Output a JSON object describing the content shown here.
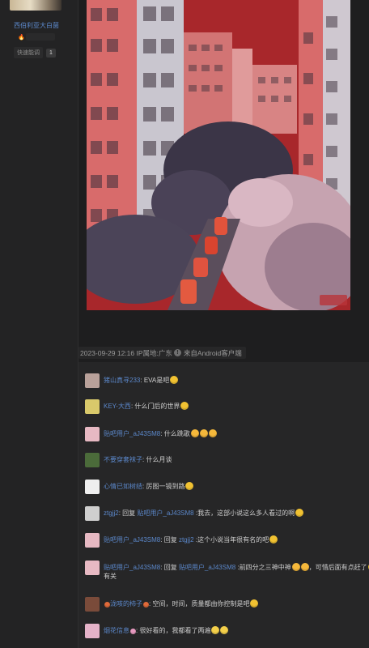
{
  "sidebar": {
    "forum_name": "西伯利亚大白菌",
    "badge_icon": "fire-icon",
    "quick_reply_label": "快速能调",
    "quick_reply_count": "1"
  },
  "post": {
    "photo_watermark": "贴吧",
    "meta_time": "2023-09-29 12:16",
    "meta_ip": "IP属地:广东",
    "meta_client": "来自Android客户端",
    "meta_info_icon": "!"
  },
  "comments": [
    {
      "user": "猪山真寻233",
      "sep": ":",
      "text": " EVA是吧",
      "emoji": 1,
      "avatar": "#b9a19a"
    },
    {
      "user": "KEY-大西",
      "sep": ":",
      "text": " 什么门后的世界",
      "emoji": 1,
      "avatar": "#d9c96b"
    },
    {
      "user": "贴吧用户_aJ43SM8",
      "sep": ":",
      "text": " 什么跳歌",
      "emoji": 3,
      "avatar": "#e7b9c3"
    },
    {
      "user": "不要穿套袜子",
      "sep": ":",
      "text": " 什么月谈",
      "emoji": 0,
      "avatar": "#4b6b3a"
    },
    {
      "user": "心情已如树结",
      "sep": ":",
      "text": " 厉图一镜到路",
      "emoji": 1,
      "avatar": "#efefef"
    },
    {
      "user": "ztgjj2",
      "sep": ":",
      "reply_word": " 回复 ",
      "reply_to": "贴吧用户_aJ43SM8",
      "text": " :我去，这部小说这么多人看过的啊",
      "emoji": 1,
      "avatar": "#cfcfcf"
    },
    {
      "user": "贴吧用户_aJ43SM8",
      "sep": ":",
      "reply_word": " 回复 ",
      "reply_to": "ztgjj2",
      "text": " :这个小说当年很有名的吧",
      "emoji": 1,
      "avatar": "#e7b9c3"
    },
    {
      "user": "贴吧用户_aJ43SM8",
      "sep": ":",
      "reply_word": " 回复 ",
      "reply_to": "贴吧用户_aJ43SM8",
      "text": " :前四分之三神中神",
      "emoji": 2,
      "text2": "，可惜后面有点赶了",
      "emoji2": 2,
      "line2": "有关",
      "avatar": "#e7b9c3"
    },
    {
      "user": "泷咳的柿子",
      "sep": ":",
      "text": " 空间，时间，质量都由你控制是吧",
      "emoji": 1,
      "avatar": "#7a4b3a"
    },
    {
      "user": "烟花信息",
      "sep": ":",
      "text": " 很好看的，我都看了两遍",
      "emoji": 2,
      "avatar": "#e5b3c9"
    }
  ]
}
